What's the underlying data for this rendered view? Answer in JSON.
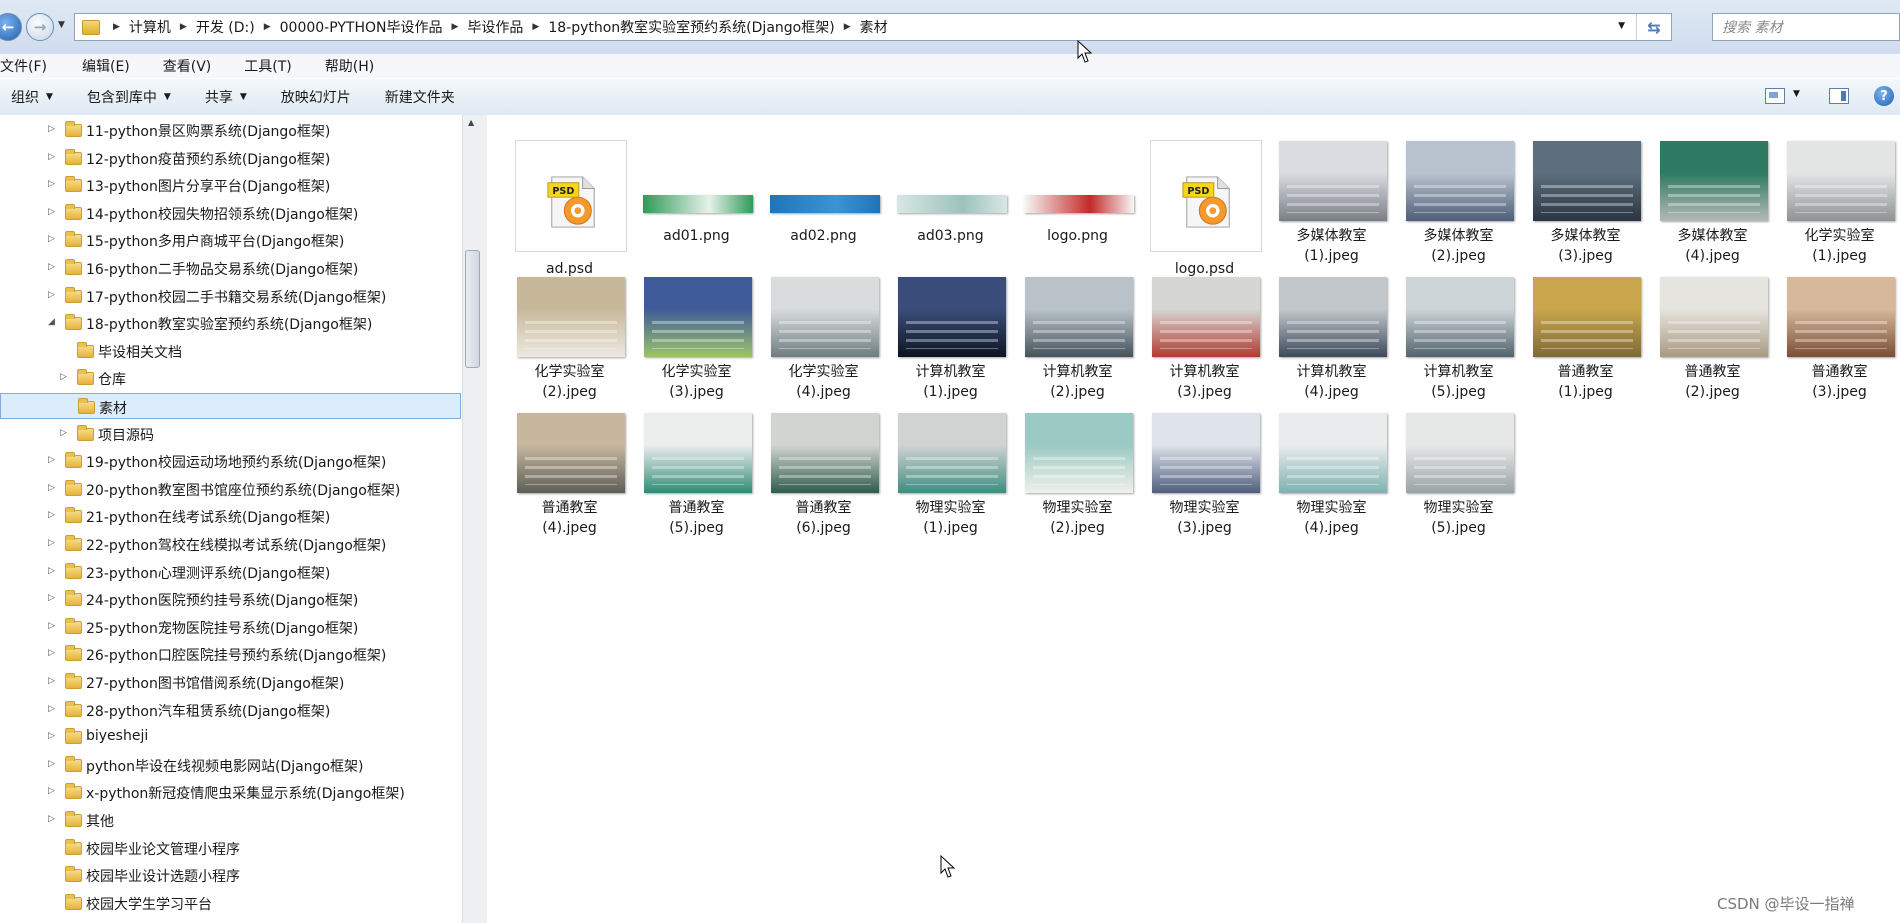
{
  "addressbar": {
    "path": [
      "计算机",
      "开发 (D:)",
      "00000-PYTHON毕设作品",
      "毕设作品",
      "18-python教室实验室预约系统(Django框架)",
      "素材"
    ],
    "search_placeholder": "搜索 素材"
  },
  "menu": [
    "文件(F)",
    "编辑(E)",
    "查看(V)",
    "工具(T)",
    "帮助(H)"
  ],
  "commands": [
    {
      "label": "组织",
      "dropdown": true
    },
    {
      "label": "包含到库中",
      "dropdown": true
    },
    {
      "label": "共享",
      "dropdown": true
    },
    {
      "label": "放映幻灯片",
      "dropdown": false
    },
    {
      "label": "新建文件夹",
      "dropdown": false
    }
  ],
  "tree": [
    {
      "label": "11-python景区购票系统(Django框架)",
      "level": 0,
      "expander": "collapsed"
    },
    {
      "label": "12-python疫苗预约系统(Django框架)",
      "level": 0,
      "expander": "collapsed"
    },
    {
      "label": "13-python图片分享平台(Django框架)",
      "level": 0,
      "expander": "collapsed"
    },
    {
      "label": "14-python校园失物招领系统(Django框架)",
      "level": 0,
      "expander": "collapsed"
    },
    {
      "label": "15-python多用户商城平台(Django框架)",
      "level": 0,
      "expander": "collapsed"
    },
    {
      "label": "16-python二手物品交易系统(Django框架)",
      "level": 0,
      "expander": "collapsed"
    },
    {
      "label": "17-python校园二手书籍交易系统(Django框架)",
      "level": 0,
      "expander": "collapsed"
    },
    {
      "label": "18-python教室实验室预约系统(Django框架)",
      "level": 0,
      "expander": "expanded"
    },
    {
      "label": "毕设相关文档",
      "level": 1,
      "expander": "none"
    },
    {
      "label": "仓库",
      "level": 1,
      "expander": "collapsed"
    },
    {
      "label": "素材",
      "level": 1,
      "expander": "none",
      "selected": true
    },
    {
      "label": "项目源码",
      "level": 1,
      "expander": "collapsed"
    },
    {
      "label": "19-python校园运动场地预约系统(Django框架)",
      "level": 0,
      "expander": "collapsed"
    },
    {
      "label": "20-python教室图书馆座位预约系统(Django框架)",
      "level": 0,
      "expander": "collapsed"
    },
    {
      "label": "21-python在线考试系统(Django框架)",
      "level": 0,
      "expander": "collapsed"
    },
    {
      "label": "22-python驾校在线模拟考试系统(Django框架)",
      "level": 0,
      "expander": "collapsed"
    },
    {
      "label": "23-python心理测评系统(Django框架)",
      "level": 0,
      "expander": "collapsed"
    },
    {
      "label": "24-python医院预约挂号系统(Django框架)",
      "level": 0,
      "expander": "collapsed"
    },
    {
      "label": "25-python宠物医院挂号系统(Django框架)",
      "level": 0,
      "expander": "collapsed"
    },
    {
      "label": "26-python口腔医院挂号预约系统(Django框架)",
      "level": 0,
      "expander": "collapsed"
    },
    {
      "label": "27-python图书馆借阅系统(Django框架)",
      "level": 0,
      "expander": "collapsed"
    },
    {
      "label": "28-python汽车租赁系统(Django框架)",
      "level": 0,
      "expander": "collapsed"
    },
    {
      "label": "biyesheji",
      "level": 0,
      "expander": "collapsed"
    },
    {
      "label": "python毕设在线视频电影网站(Django框架)",
      "level": 0,
      "expander": "collapsed"
    },
    {
      "label": "x-python新冠疫情爬虫采集显示系统(Django框架)",
      "level": 0,
      "expander": "collapsed"
    },
    {
      "label": "其他",
      "level": 0,
      "expander": "collapsed"
    },
    {
      "label": "校园毕业论文管理小程序",
      "level": 0,
      "expander": "none"
    },
    {
      "label": "校园毕业设计选题小程序",
      "level": 0,
      "expander": "none"
    },
    {
      "label": "校园大学生学习平台",
      "level": 0,
      "expander": "none"
    }
  ],
  "files": [
    {
      "line1": "ad.psd",
      "line2": "",
      "kind": "psd",
      "psd_label": "PSD"
    },
    {
      "line1": "ad01.png",
      "line2": "",
      "kind": "banner",
      "c1": "#2f9a58",
      "c2": "#e6f2ea"
    },
    {
      "line1": "ad02.png",
      "line2": "",
      "kind": "banner",
      "c1": "#1f74b8",
      "c2": "#3b94d4"
    },
    {
      "line1": "ad03.png",
      "line2": "",
      "kind": "banner",
      "c1": "#d8e7e4",
      "c2": "#9cc2bc"
    },
    {
      "line1": "logo.png",
      "line2": "",
      "kind": "banner",
      "c1": "#f7f7f7",
      "c2": "#c42a2a"
    },
    {
      "line1": "logo.psd",
      "line2": "",
      "kind": "psd",
      "psd_label": "PSD"
    },
    {
      "line1": "多媒体教室",
      "line2": "(1).jpeg",
      "kind": "photo",
      "c1": "#d9dde2",
      "c2": "#7a7e86"
    },
    {
      "line1": "多媒体教室",
      "line2": "(2).jpeg",
      "kind": "photo",
      "c1": "#b9c2cf",
      "c2": "#4e5f79"
    },
    {
      "line1": "多媒体教室",
      "line2": "(3).jpeg",
      "kind": "photo",
      "c1": "#5d6f7e",
      "c2": "#2a3540"
    },
    {
      "line1": "多媒体教室",
      "line2": "(4).jpeg",
      "kind": "photo",
      "c1": "#2f7a62",
      "c2": "#b5b8b7"
    },
    {
      "line1": "化学实验室",
      "line2": "(1).jpeg",
      "kind": "photo",
      "c1": "#e4e6e6",
      "c2": "#8d9293"
    },
    {
      "line1": "化学实验室",
      "line2": "(2).jpeg",
      "kind": "photo",
      "c1": "#c8b89a",
      "c2": "#ece9e1"
    },
    {
      "line1": "化学实验室",
      "line2": "(3).jpeg",
      "kind": "photo",
      "c1": "#3f5b9a",
      "c2": "#9cc36a"
    },
    {
      "line1": "化学实验室",
      "line2": "(4).jpeg",
      "kind": "photo",
      "c1": "#d8dcdc",
      "c2": "#6f7d80"
    },
    {
      "line1": "计算机教室",
      "line2": "(1).jpeg",
      "kind": "photo",
      "c1": "#3a4d7a",
      "c2": "#0e1424"
    },
    {
      "line1": "计算机教室",
      "line2": "(2).jpeg",
      "kind": "photo",
      "c1": "#b8c2c8",
      "c2": "#47535c"
    },
    {
      "line1": "计算机教室",
      "line2": "(3).jpeg",
      "kind": "photo",
      "c1": "#d6d6d2",
      "c2": "#b23a30"
    },
    {
      "line1": "计算机教室",
      "line2": "(4).jpeg",
      "kind": "photo",
      "c1": "#c2c7cc",
      "c2": "#3d4a5a"
    },
    {
      "line1": "计算机教室",
      "line2": "(5).jpeg",
      "kind": "photo",
      "c1": "#cdd5d8",
      "c2": "#52636b"
    },
    {
      "line1": "普通教室",
      "line2": "(1).jpeg",
      "kind": "photo",
      "c1": "#c9a64c",
      "c2": "#7f6a38"
    },
    {
      "line1": "普通教室",
      "line2": "(2).jpeg",
      "kind": "photo",
      "c1": "#e6e4de",
      "c2": "#a99a82"
    },
    {
      "line1": "普通教室",
      "line2": "(3).jpeg",
      "kind": "photo",
      "c1": "#d7b89a",
      "c2": "#7a4e35"
    },
    {
      "line1": "普通教室",
      "line2": "(4).jpeg",
      "kind": "photo",
      "c1": "#c8b79f",
      "c2": "#5d5e58"
    },
    {
      "line1": "普通教室",
      "line2": "(5).jpeg",
      "kind": "photo",
      "c1": "#eceeee",
      "c2": "#2f8b76"
    },
    {
      "line1": "普通教室",
      "line2": "(6).jpeg",
      "kind": "photo",
      "c1": "#d2d4d0",
      "c2": "#2e5c4c"
    },
    {
      "line1": "物理实验室",
      "line2": "(1).jpeg",
      "kind": "photo",
      "c1": "#cfd3d2",
      "c2": "#3f8d82"
    },
    {
      "line1": "物理实验室",
      "line2": "(2).jpeg",
      "kind": "photo",
      "c1": "#9bc9c3",
      "c2": "#f0f0ec"
    },
    {
      "line1": "物理实验室",
      "line2": "(3).jpeg",
      "kind": "photo",
      "c1": "#dfe3ea",
      "c2": "#4e5e7e"
    },
    {
      "line1": "物理实验室",
      "line2": "(4).jpeg",
      "kind": "photo",
      "c1": "#e8ecec",
      "c2": "#7fb1b0"
    },
    {
      "line1": "物理实验室",
      "line2": "(5).jpeg",
      "kind": "photo",
      "c1": "#e6e8e8",
      "c2": "#9aa2a4"
    }
  ],
  "watermark": "CSDN @毕设一指禅"
}
